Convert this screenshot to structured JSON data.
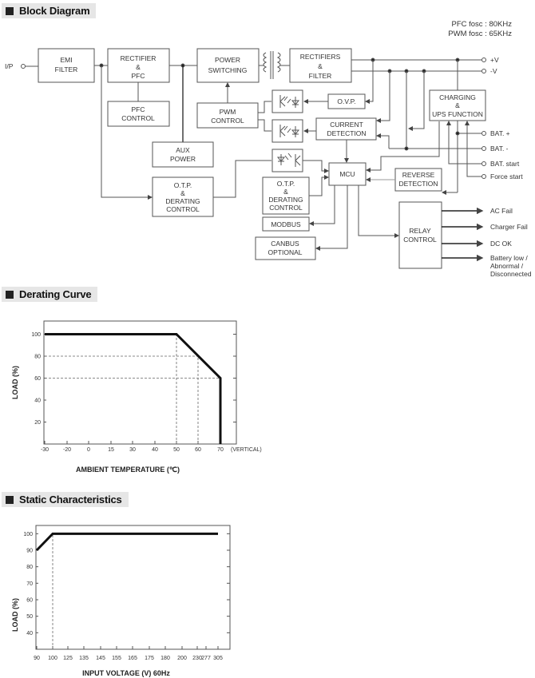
{
  "sections": {
    "block_diagram": "Block Diagram",
    "derating_curve": "Derating Curve",
    "static_characteristics": "Static Characteristics"
  },
  "block_diagram": {
    "frequencies": [
      "PFC fosc : 80KHz",
      "PWM fosc : 65KHz"
    ],
    "input_label": "I/P",
    "blocks": {
      "emi_filter": [
        "EMI",
        "FILTER"
      ],
      "rectifier_pfc": [
        "RECTIFIER",
        "&",
        "PFC"
      ],
      "pfc_control": [
        "PFC",
        "CONTROL"
      ],
      "power_switching": [
        "POWER",
        "SWITCHING"
      ],
      "pwm_control": [
        "PWM",
        "CONTROL"
      ],
      "aux_power": [
        "AUX",
        "POWER"
      ],
      "otp_derating_main": [
        "O.T.P.",
        "&",
        "DERATING",
        "CONTROL"
      ],
      "rectifiers_filter": [
        "RECTIFIERS",
        "&",
        "FILTER"
      ],
      "ovp": [
        "O.V.P."
      ],
      "current_detection": [
        "CURRENT",
        "DETECTION"
      ],
      "mcu": [
        "MCU"
      ],
      "otp_derating_secondary": [
        "O.T.P.",
        "&",
        "DERATING",
        "CONTROL"
      ],
      "modbus": [
        "MODBUS"
      ],
      "canbus": [
        "CANBUS",
        "OPTIONAL"
      ],
      "charging_ups": [
        "CHARGING",
        "&",
        "UPS FUNCTION"
      ],
      "reverse_detection": [
        "REVERSE",
        "DETECTION"
      ],
      "relay_control": [
        "RELAY",
        "CONTROL"
      ]
    },
    "terminals": [
      "+V",
      "-V",
      "BAT. +",
      "BAT. -",
      "BAT. start",
      "Force start"
    ],
    "relay_outputs": [
      "AC Fail",
      "Charger Fail",
      "DC OK",
      "Battery low /",
      "Abnormal /",
      "Disconnected"
    ]
  },
  "chart_data": [
    {
      "type": "line",
      "title": "Derating Curve",
      "xlabel": "AMBIENT TEMPERATURE (℃)",
      "ylabel": "LOAD (%)",
      "x_ticks": [
        "-30",
        "-20",
        "0",
        "15",
        "30",
        "40",
        "50",
        "60",
        "70"
      ],
      "x_extra_label": "(VERTICAL)",
      "y_ticks": [
        "100",
        "80",
        "60",
        "40",
        "20"
      ],
      "y_tick_values": [
        100,
        80,
        60,
        40,
        20
      ],
      "ylim": [
        0,
        112
      ],
      "series": [
        {
          "name": "Load",
          "points": [
            [
              "-30",
              100
            ],
            [
              "50",
              100
            ],
            [
              "70",
              60
            ],
            [
              "70",
              0
            ]
          ]
        }
      ],
      "reference_lines": [
        {
          "from": [
            "-30",
            80
          ],
          "to": [
            "60",
            80
          ]
        },
        {
          "from": [
            "-30",
            60
          ],
          "to": [
            "70",
            60
          ]
        },
        {
          "from": [
            "50",
            0
          ],
          "to": [
            "50",
            100
          ]
        },
        {
          "from": [
            "60",
            0
          ],
          "to": [
            "60",
            80
          ]
        }
      ],
      "grid": false
    },
    {
      "type": "line",
      "title": "Static Characteristics",
      "xlabel": "INPUT VOLTAGE (V) 60Hz",
      "ylabel": "LOAD (%)",
      "x_ticks": [
        "90",
        "100",
        "125",
        "135",
        "145",
        "155",
        "165",
        "175",
        "180",
        "200",
        "230",
        "277",
        "305"
      ],
      "y_ticks": [
        "100",
        "90",
        "80",
        "70",
        "60",
        "50",
        "40"
      ],
      "y_tick_values": [
        100,
        90,
        80,
        70,
        60,
        50,
        40
      ],
      "ylim": [
        30,
        105
      ],
      "series": [
        {
          "name": "Load",
          "points": [
            [
              "90",
              90
            ],
            [
              "100",
              100
            ],
            [
              "305",
              100
            ]
          ]
        }
      ],
      "reference_lines": [
        {
          "from": [
            "100",
            30
          ],
          "to": [
            "100",
            100
          ]
        }
      ],
      "grid": false
    }
  ]
}
